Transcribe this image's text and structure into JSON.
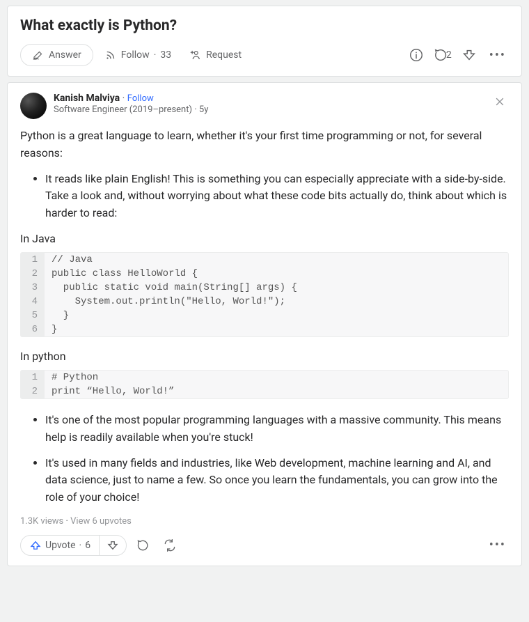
{
  "question": {
    "title": "What exactly is Python?",
    "answer_label": "Answer",
    "follow_label": "Follow",
    "follow_count": "33",
    "request_label": "Request",
    "comment_count": "2"
  },
  "answer": {
    "author_name": "Kanish Malviya",
    "follow_link": "Follow",
    "credential": "Software Engineer (2019–present)",
    "time": "5y",
    "intro": "Python is a great language to learn, whether it's your first time programming or not, for several reasons:",
    "bullet1": "It reads like plain English! This is something you can especially appreciate with a side-by-side. Take a look and, without worrying about what these code bits actually do, think about which is harder to read:",
    "label_java": "In Java",
    "code_java": [
      "// Java",
      "public class HelloWorld {",
      "  public static void main(String[] args) {",
      "    System.out.println(\"Hello, World!\");",
      "  }",
      "}"
    ],
    "label_python": "In python",
    "code_python": [
      "# Python",
      "print “Hello, World!”"
    ],
    "bullet2": "It's one of the most popular programming languages with a massive community. This means help is readily available when you're stuck!",
    "bullet3": "It's used in many fields and industries, like Web development, machine learning and AI, and data science, just to name a few. So once you learn the fundamentals, you can grow into the role of your choice!",
    "views_text": "1.3K views",
    "upvotes_link": "View 6 upvotes",
    "upvote_label": "Upvote",
    "upvote_count": "6"
  }
}
